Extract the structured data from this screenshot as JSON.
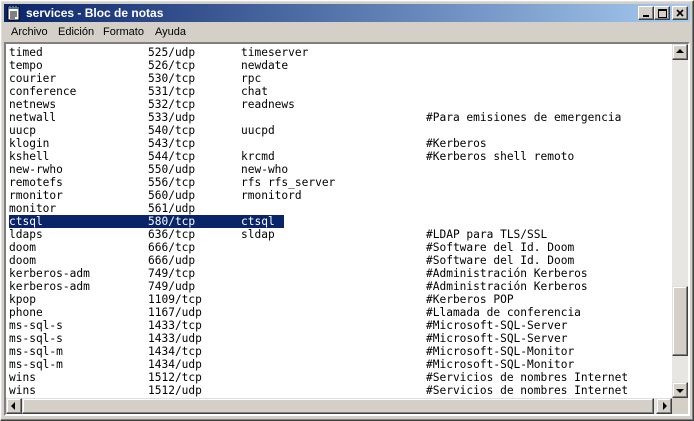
{
  "window": {
    "title": "services - Bloc de notas"
  },
  "title_buttons": {
    "minimize": "_",
    "maximize": "□",
    "close": "×"
  },
  "menu": [
    "Archivo",
    "Edición",
    "Formato",
    "Ayuda"
  ],
  "selected_line_index": 13,
  "lines": [
    {
      "name": "timed",
      "port": "525/udp",
      "alias": "timeserver",
      "comment": ""
    },
    {
      "name": "tempo",
      "port": "526/tcp",
      "alias": "newdate",
      "comment": ""
    },
    {
      "name": "courier",
      "port": "530/tcp",
      "alias": "rpc",
      "comment": ""
    },
    {
      "name": "conference",
      "port": "531/tcp",
      "alias": "chat",
      "comment": ""
    },
    {
      "name": "netnews",
      "port": "532/tcp",
      "alias": "readnews",
      "comment": ""
    },
    {
      "name": "netwall",
      "port": "533/udp",
      "alias": "",
      "comment": "#Para emisiones de emergencia"
    },
    {
      "name": "uucp",
      "port": "540/tcp",
      "alias": "uucpd",
      "comment": ""
    },
    {
      "name": "klogin",
      "port": "543/tcp",
      "alias": "",
      "comment": "#Kerberos"
    },
    {
      "name": "kshell",
      "port": "544/tcp",
      "alias": "krcmd",
      "comment": "#Kerberos shell remoto"
    },
    {
      "name": "new-rwho",
      "port": "550/udp",
      "alias": "new-who",
      "comment": ""
    },
    {
      "name": "remotefs",
      "port": "556/tcp",
      "alias": "rfs rfs_server",
      "comment": ""
    },
    {
      "name": "rmonitor",
      "port": "560/udp",
      "alias": "rmonitord",
      "comment": ""
    },
    {
      "name": "monitor",
      "port": "561/udp",
      "alias": "",
      "comment": ""
    },
    {
      "name": "ctsql",
      "port": "580/tcp",
      "alias": "ctsql",
      "comment": ""
    },
    {
      "name": "ldaps",
      "port": "636/tcp",
      "alias": "sldap",
      "comment": "#LDAP para TLS/SSL"
    },
    {
      "name": "doom",
      "port": "666/tcp",
      "alias": "",
      "comment": "#Software del Id. Doom"
    },
    {
      "name": "doom",
      "port": "666/udp",
      "alias": "",
      "comment": "#Software del Id. Doom"
    },
    {
      "name": "kerberos-adm",
      "port": "749/tcp",
      "alias": "",
      "comment": "#Administración Kerberos"
    },
    {
      "name": "kerberos-adm",
      "port": "749/udp",
      "alias": "",
      "comment": "#Administración Kerberos"
    },
    {
      "name": "kpop",
      "port": "1109/tcp",
      "alias": "",
      "comment": "#Kerberos POP"
    },
    {
      "name": "phone",
      "port": "1167/udp",
      "alias": "",
      "comment": "#Llamada de conferencia"
    },
    {
      "name": "ms-sql-s",
      "port": "1433/tcp",
      "alias": "",
      "comment": "#Microsoft-SQL-Server"
    },
    {
      "name": "ms-sql-s",
      "port": "1433/udp",
      "alias": "",
      "comment": "#Microsoft-SQL-Server"
    },
    {
      "name": "ms-sql-m",
      "port": "1434/tcp",
      "alias": "",
      "comment": "#Microsoft-SQL-Monitor"
    },
    {
      "name": "ms-sql-m",
      "port": "1434/udp",
      "alias": "",
      "comment": "#Microsoft-SQL-Monitor"
    },
    {
      "name": "wins",
      "port": "1512/tcp",
      "alias": "",
      "comment": "#Servicios de nombres Internet"
    },
    {
      "name": "wins",
      "port": "1512/udp",
      "alias": "",
      "comment": "#Servicios de nombres Internet"
    }
  ],
  "colors": {
    "title_active": "#0a246a",
    "title_gradient_end": "#a6caf0",
    "selection": "#0a246a",
    "chrome": "#d4d0c8"
  },
  "icons": {
    "app": "notepad-icon"
  }
}
